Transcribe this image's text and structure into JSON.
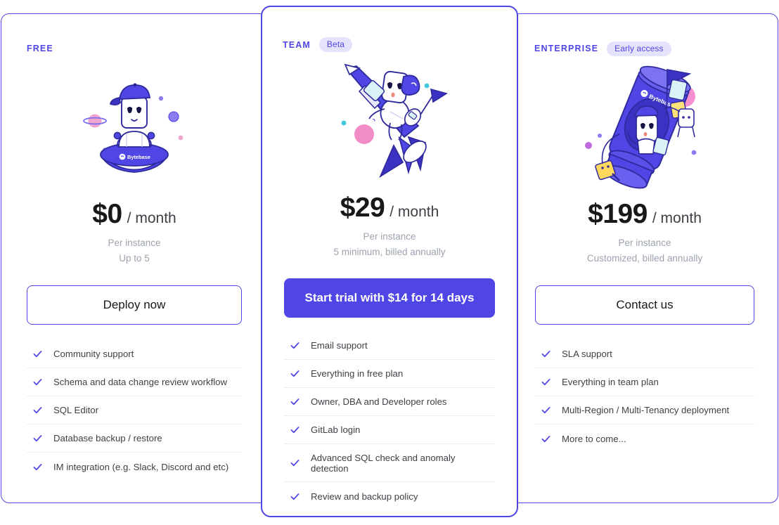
{
  "accent_color": "#4f46e5",
  "badge_bg_color": "#e4e3fb",
  "text_color": "#3f3f46",
  "price_color": "#18181b",
  "muted_color": "#9ca3af",
  "divider_color": "#ececf1",
  "brand": "Bytebase",
  "plans": [
    {
      "name": "FREE",
      "badge": "",
      "illustration": "ufo-mascot-illustration",
      "price_amount": "$0",
      "price_period": "/ month",
      "price_note_1": "Per instance",
      "price_note_2": "Up to 5",
      "cta_label": "Deploy now",
      "cta_style": "outline",
      "features": [
        "Community support",
        "Schema and data change review workflow",
        "SQL Editor",
        "Database backup / restore",
        "IM integration (e.g. Slack, Discord and etc)"
      ]
    },
    {
      "name": "TEAM",
      "badge": "Beta",
      "illustration": "rocket-mascot-illustration",
      "price_amount": "$29",
      "price_period": "/ month",
      "price_note_1": "Per instance",
      "price_note_2": "5 minimum, billed annually",
      "cta_label": "Start trial with $14 for 14 days",
      "cta_style": "filled",
      "features": [
        "Email support",
        "Everything in free plan",
        "Owner, DBA and Developer roles",
        "GitLab login",
        "Advanced SQL check and anomaly detection",
        "Review and backup policy"
      ]
    },
    {
      "name": "ENTERPRISE",
      "badge": "Early access",
      "illustration": "space-station-mascot-illustration",
      "price_amount": "$199",
      "price_period": "/ month",
      "price_note_1": "Per instance",
      "price_note_2": "Customized, billed annually",
      "cta_label": "Contact us",
      "cta_style": "outline",
      "features": [
        "SLA support",
        "Everything in team plan",
        "Multi-Region / Multi-Tenancy deployment",
        "More to come..."
      ]
    }
  ]
}
